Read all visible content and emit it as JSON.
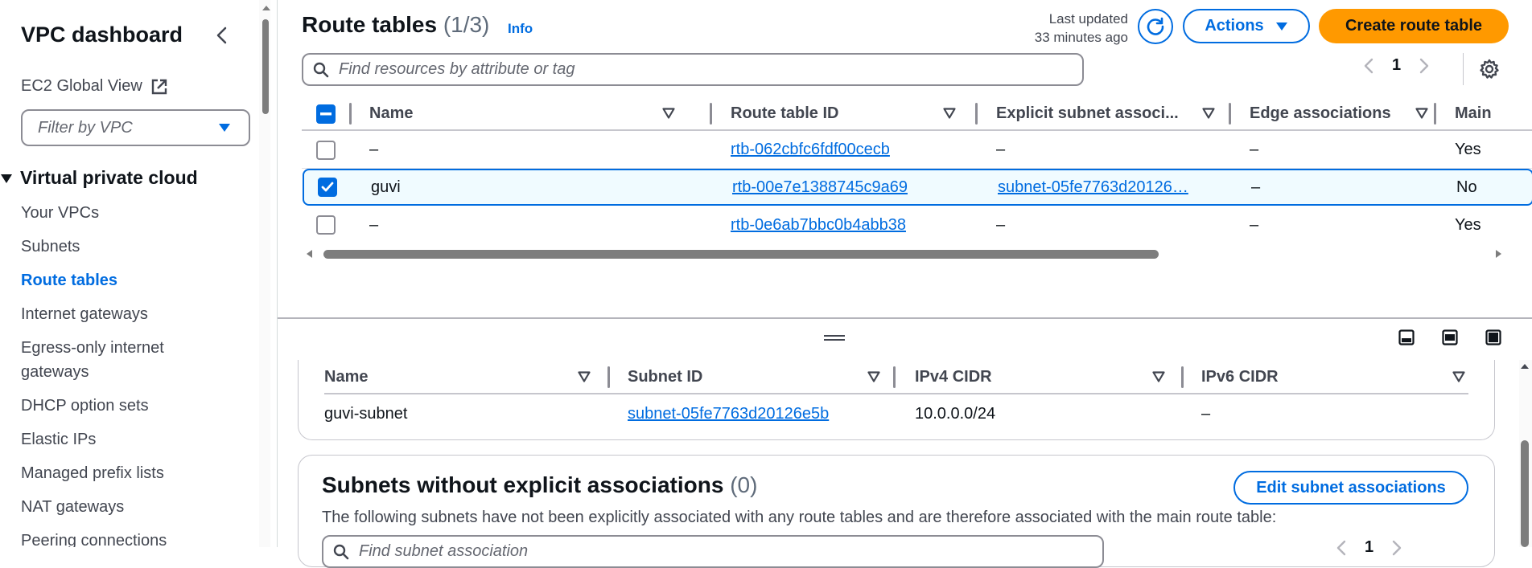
{
  "sidebar": {
    "title": "VPC dashboard",
    "ec2_global_view": "EC2 Global View",
    "filter_placeholder": "Filter by VPC",
    "section_title": "Virtual private cloud",
    "items": [
      {
        "label": "Your VPCs",
        "active": false
      },
      {
        "label": "Subnets",
        "active": false
      },
      {
        "label": "Route tables",
        "active": true
      },
      {
        "label": "Internet gateways",
        "active": false
      },
      {
        "label": "Egress-only internet",
        "active": false
      },
      {
        "label": "gateways",
        "active": false
      },
      {
        "label": "DHCP option sets",
        "active": false
      },
      {
        "label": "Elastic IPs",
        "active": false
      },
      {
        "label": "Managed prefix lists",
        "active": false
      },
      {
        "label": "NAT gateways",
        "active": false
      },
      {
        "label": "Peering connections",
        "active": false
      }
    ]
  },
  "header": {
    "title": "Route tables",
    "count": "(1/3)",
    "info": "Info",
    "last_updated_line1": "Last updated",
    "last_updated_line2": "33 minutes ago",
    "actions_label": "Actions",
    "create_label": "Create route table"
  },
  "search": {
    "placeholder": "Find resources by attribute or tag"
  },
  "pagination": {
    "current_page": "1"
  },
  "route_table": {
    "columns": [
      "Name",
      "Route table ID",
      "Explicit subnet associ...",
      "Edge associations",
      "Main"
    ],
    "rows": [
      {
        "checked": false,
        "name": "–",
        "id": "rtb-062cbfc6fdf00cecb",
        "subnet": "–",
        "subnet_link": false,
        "edge": "–",
        "main": "Yes"
      },
      {
        "checked": true,
        "name": "guvi",
        "id": "rtb-00e7e1388745c9a69",
        "subnet": "subnet-05fe7763d20126…",
        "subnet_link": true,
        "edge": "–",
        "main": "No"
      },
      {
        "checked": false,
        "name": "–",
        "id": "rtb-0e6ab7bbc0b4abb38",
        "subnet": "–",
        "subnet_link": false,
        "edge": "–",
        "main": "Yes"
      }
    ]
  },
  "subnet_assoc": {
    "columns": [
      "Name",
      "Subnet ID",
      "IPv4 CIDR",
      "IPv6 CIDR"
    ],
    "rows": [
      {
        "name": "guvi-subnet",
        "subnet_id": "subnet-05fe7763d20126e5b",
        "ipv4": "10.0.0.0/24",
        "ipv6": "–"
      }
    ]
  },
  "without_assoc": {
    "title": "Subnets without explicit associations",
    "count": "(0)",
    "edit_label": "Edit subnet associations",
    "description": "The following subnets have not been explicitly associated with any route tables and are therefore associated with the main route table:",
    "search_placeholder": "Find subnet association",
    "current_page": "1"
  },
  "colors": {
    "link": "#006ce0",
    "primary_button": "#ff9900",
    "selected_row_bg": "#f0fbff"
  }
}
